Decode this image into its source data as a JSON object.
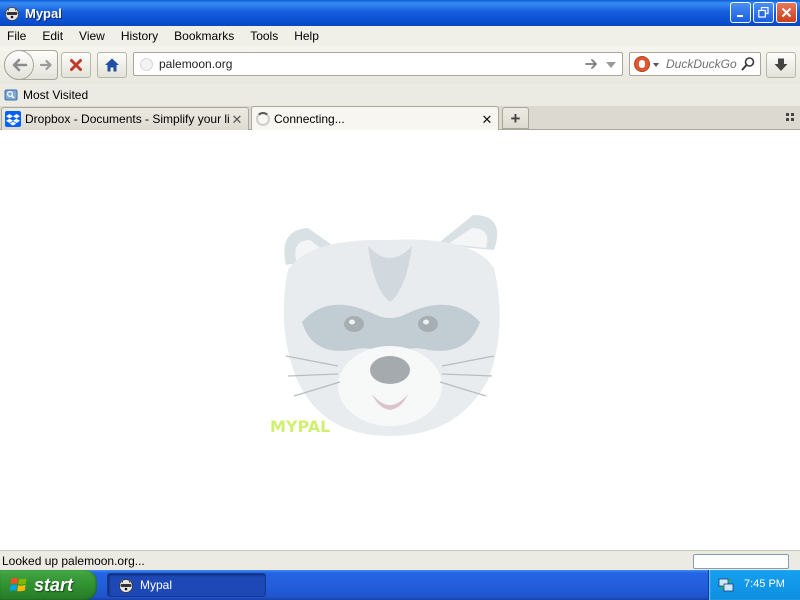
{
  "window": {
    "title": "Mypal",
    "icon": "raccoon-icon"
  },
  "caption_buttons": {
    "minimize": "minimize-icon",
    "maximize": "restore-icon",
    "close": "close-icon"
  },
  "menu": [
    {
      "label": "File"
    },
    {
      "label": "Edit"
    },
    {
      "label": "View"
    },
    {
      "label": "History"
    },
    {
      "label": "Bookmarks"
    },
    {
      "label": "Tools"
    },
    {
      "label": "Help"
    }
  ],
  "navigation": {
    "back_icon": "back-arrow-icon",
    "forward_icon": "forward-arrow-icon",
    "stop_icon": "stop-icon",
    "home_icon": "home-icon",
    "url": "palemoon.org",
    "search_engine_icon": "duckduckgo-icon",
    "search_placeholder": "DuckDuckGo",
    "download_icon": "download-arrow-icon"
  },
  "bookmarks": {
    "items": [
      {
        "label": "Most Visited",
        "icon": "bookmark-folder-icon"
      }
    ]
  },
  "tabs": [
    {
      "label": "Dropbox - Documents - Simplify your life",
      "icon": "dropbox-icon",
      "selected": false
    },
    {
      "label": "Connecting...",
      "icon": "loading-spinner-icon",
      "selected": true
    }
  ],
  "status": {
    "text": "Looked up palemoon.org..."
  },
  "taskbar": {
    "start_label": "start",
    "items": [
      {
        "label": "Mypal",
        "icon": "raccoon-icon"
      }
    ],
    "clock": "7:45 PM"
  },
  "colors": {
    "titlebar": "#0b4fd0",
    "taskbar": "#245edb",
    "start_button": "#3c9f3c",
    "tray": "#0f8fe0",
    "chrome": "#ecebe3",
    "stop_red": "#c0392b",
    "home_blue": "#1f4fa0",
    "dropbox_blue": "#0061fe"
  }
}
